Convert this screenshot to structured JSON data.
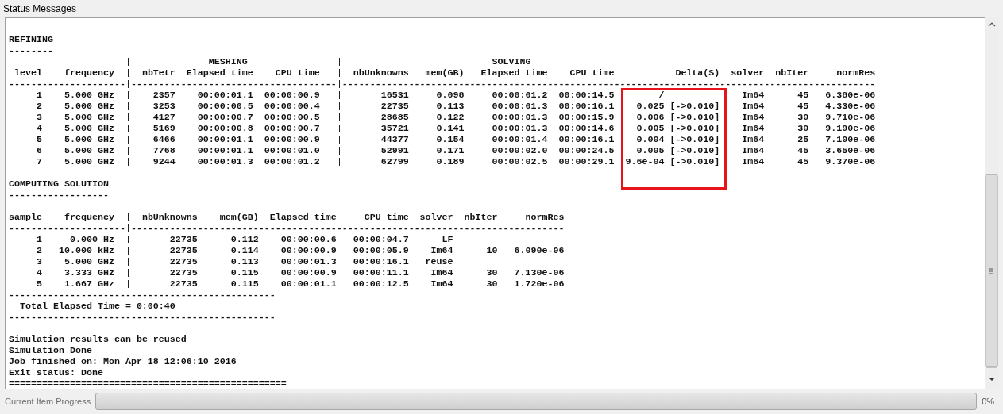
{
  "panel": {
    "title": "Status Messages"
  },
  "refining": {
    "title": "REFINING",
    "underline": "--------",
    "groups": {
      "meshing": "MESHING",
      "solving": "SOLVING"
    },
    "header": {
      "level": "level",
      "frequency": "frequency",
      "nbTetr": "nbTetr",
      "mesh_elapsed": "Elapsed time",
      "mesh_cpu": "CPU time",
      "nbUnknowns": "nbUnknowns",
      "mem": "mem(GB)",
      "solve_elapsed": "Elapsed time",
      "solve_cpu": "CPU time",
      "delta_target": "Delta(S)",
      "solver": "solver",
      "nbIter": "nbIter",
      "normRes": "normRes"
    },
    "rule": [
      "---------------------",
      "-------------------------------------",
      "------------------------------------------------------------------------------------------------"
    ],
    "rows": [
      {
        "level": "1",
        "frequency": "5.000 GHz",
        "nbTetr": "2357",
        "mesh_elapsed": "00:00:01.1",
        "mesh_cpu": "00:00:00.9",
        "nbUnknowns": "16531",
        "mem": "0.098",
        "solve_elapsed": "00:00:01.2",
        "solve_cpu": "00:00:14.5",
        "delta": "/",
        "solver": "Im64",
        "nbIter": "45",
        "normRes": "6.380e-06"
      },
      {
        "level": "2",
        "frequency": "5.000 GHz",
        "nbTetr": "3253",
        "mesh_elapsed": "00:00:00.5",
        "mesh_cpu": "00:00:00.4",
        "nbUnknowns": "22735",
        "mem": "0.113",
        "solve_elapsed": "00:00:01.3",
        "solve_cpu": "00:00:16.1",
        "delta": "0.025",
        "delta_target": "[->0.010]",
        "solver": "Im64",
        "nbIter": "45",
        "normRes": "4.330e-06"
      },
      {
        "level": "3",
        "frequency": "5.000 GHz",
        "nbTetr": "4127",
        "mesh_elapsed": "00:00:00.7",
        "mesh_cpu": "00:00:00.5",
        "nbUnknowns": "28685",
        "mem": "0.122",
        "solve_elapsed": "00:00:01.3",
        "solve_cpu": "00:00:15.9",
        "delta": "0.006",
        "delta_target": "[->0.010]",
        "solver": "Im64",
        "nbIter": "30",
        "normRes": "9.710e-06"
      },
      {
        "level": "4",
        "frequency": "5.000 GHz",
        "nbTetr": "5169",
        "mesh_elapsed": "00:00:00.8",
        "mesh_cpu": "00:00:00.7",
        "nbUnknowns": "35721",
        "mem": "0.141",
        "solve_elapsed": "00:00:01.3",
        "solve_cpu": "00:00:14.6",
        "delta": "0.005",
        "delta_target": "[->0.010]",
        "solver": "Im64",
        "nbIter": "30",
        "normRes": "9.190e-06"
      },
      {
        "level": "5",
        "frequency": "5.000 GHz",
        "nbTetr": "6466",
        "mesh_elapsed": "00:00:01.1",
        "mesh_cpu": "00:00:00.9",
        "nbUnknowns": "44377",
        "mem": "0.154",
        "solve_elapsed": "00:00:01.4",
        "solve_cpu": "00:00:16.1",
        "delta": "0.004",
        "delta_target": "[->0.010]",
        "solver": "Im64",
        "nbIter": "25",
        "normRes": "7.100e-06"
      },
      {
        "level": "6",
        "frequency": "5.000 GHz",
        "nbTetr": "7768",
        "mesh_elapsed": "00:00:01.1",
        "mesh_cpu": "00:00:01.0",
        "nbUnknowns": "52991",
        "mem": "0.171",
        "solve_elapsed": "00:00:02.0",
        "solve_cpu": "00:00:24.5",
        "delta": "0.005",
        "delta_target": "[->0.010]",
        "solver": "Im64",
        "nbIter": "45",
        "normRes": "3.650e-06"
      },
      {
        "level": "7",
        "frequency": "5.000 GHz",
        "nbTetr": "9244",
        "mesh_elapsed": "00:00:01.3",
        "mesh_cpu": "00:00:01.2",
        "nbUnknowns": "62799",
        "mem": "0.189",
        "solve_elapsed": "00:00:02.5",
        "solve_cpu": "00:00:29.1",
        "delta": "9.6e-04",
        "delta_target": "[->0.010]",
        "solver": "Im64",
        "nbIter": "45",
        "normRes": "9.370e-06"
      }
    ]
  },
  "computing": {
    "title": "COMPUTING SOLUTION",
    "underline": "------------------",
    "header": {
      "sample": "sample",
      "frequency": "frequency",
      "nbUnknowns": "nbUnknowns",
      "mem": "mem(GB)",
      "elapsed": "Elapsed time",
      "cpu": "CPU time",
      "solver": "solver",
      "nbIter": "nbIter",
      "normRes": "normRes"
    },
    "rule": [
      "---------------------",
      "------------------------------------------------------------------------------"
    ],
    "rows": [
      {
        "sample": "1",
        "frequency": "0.000 Hz",
        "nbUnknowns": "22735",
        "mem": "0.112",
        "elapsed": "00:00:00.6",
        "cpu": "00:00:04.7",
        "solver": "LF"
      },
      {
        "sample": "2",
        "frequency": "10.000 kHz",
        "nbUnknowns": "22735",
        "mem": "0.114",
        "elapsed": "00:00:00.9",
        "cpu": "00:00:05.9",
        "solver": "Im64",
        "nbIter": "10",
        "normRes": "6.090e-06"
      },
      {
        "sample": "3",
        "frequency": "5.000 GHz",
        "nbUnknowns": "22735",
        "mem": "0.113",
        "elapsed": "00:00:01.3",
        "cpu": "00:00:16.1",
        "solver": "reuse"
      },
      {
        "sample": "4",
        "frequency": "3.333 GHz",
        "nbUnknowns": "22735",
        "mem": "0.115",
        "elapsed": "00:00:00.9",
        "cpu": "00:00:11.1",
        "solver": "Im64",
        "nbIter": "30",
        "normRes": "7.130e-06"
      },
      {
        "sample": "5",
        "frequency": "1.667 GHz",
        "nbUnknowns": "22735",
        "mem": "0.115",
        "elapsed": "00:00:01.1",
        "cpu": "00:00:12.5",
        "solver": "Im64",
        "nbIter": "30",
        "normRes": "1.720e-06"
      }
    ]
  },
  "total": {
    "rule_above": "------------------------------------------------",
    "text": "Total Elapsed Time = 0:00:40",
    "rule_below": "------------------------------------------------"
  },
  "messages": [
    "Simulation results can be reused",
    "Simulation Done",
    "Job finished on: Mon Apr 18 12:06:10 2016",
    "Exit status: Done"
  ],
  "end_rule": "==================================================",
  "progress": {
    "label": "Current Item Progress",
    "level": 0,
    "percent": "0%"
  }
}
